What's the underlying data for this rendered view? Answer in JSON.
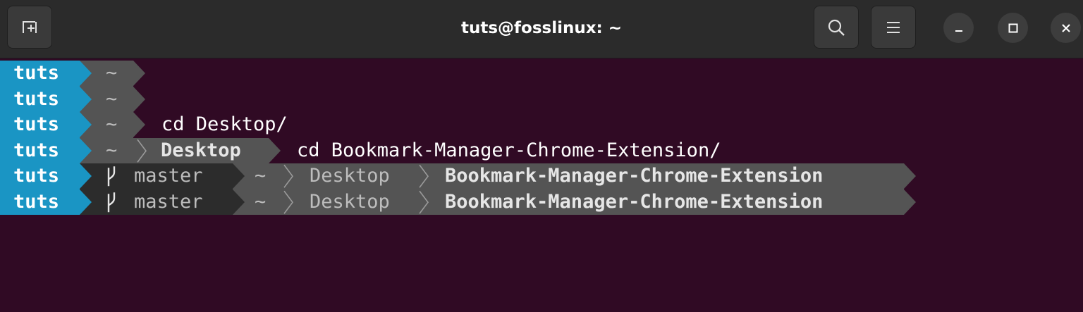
{
  "window": {
    "title": "tuts@fosslinux: ~",
    "new_tab_icon": "new-tab-icon",
    "search_icon": "search-icon",
    "menu_icon": "hamburger-menu-icon",
    "minimize_icon": "minimize-icon",
    "maximize_icon": "maximize-icon",
    "close_icon": "close-icon"
  },
  "colors": {
    "terminal_bg": "#300a24",
    "user_segment": "#1a95c4",
    "path_segment": "#545454",
    "git_segment": "#2c2c2c"
  },
  "prompt": {
    "user": "tuts",
    "home": "~",
    "git_branch": "master",
    "desktop": "Desktop",
    "repo": "Bookmark-Manager-Chrome-Extension"
  },
  "lines": [
    {
      "user": "tuts",
      "home": "~",
      "command": ""
    },
    {
      "user": "tuts",
      "home": "~",
      "command": ""
    },
    {
      "user": "tuts",
      "home": "~",
      "command": "cd Desktop/"
    },
    {
      "user": "tuts",
      "home": "~",
      "dir": "Desktop",
      "command": "cd Bookmark-Manager-Chrome-Extension/"
    },
    {
      "user": "tuts",
      "branch": "master",
      "home": "~",
      "dir": "Desktop",
      "repo": "Bookmark-Manager-Chrome-Extension"
    },
    {
      "user": "tuts",
      "branch": "master",
      "home": "~",
      "dir": "Desktop",
      "repo": "Bookmark-Manager-Chrome-Extension"
    }
  ]
}
